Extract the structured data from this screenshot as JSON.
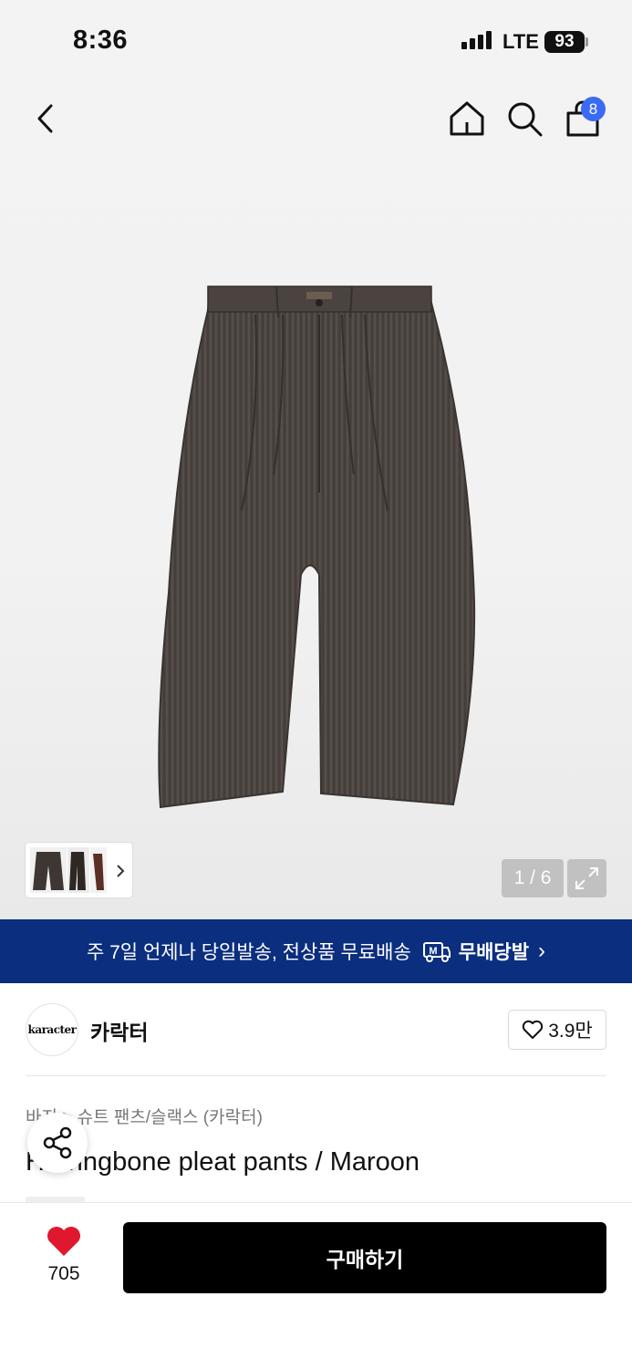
{
  "status_bar": {
    "time": "8:36",
    "network": "LTE",
    "battery": "93"
  },
  "nav": {
    "cart_count": "8",
    "icons": [
      "back-icon",
      "home-icon",
      "search-icon",
      "cart-icon"
    ]
  },
  "gallery": {
    "counter": "1 / 6",
    "icons": [
      "chevron-right-icon",
      "expand-icon"
    ]
  },
  "banner": {
    "text": "주 7일 언제나 당일발송, 전상품 무료배송",
    "brand": "무배당발",
    "chevron": "›"
  },
  "seller": {
    "logo_text": "karacter",
    "name": "카락터",
    "likes": "3.9만"
  },
  "product": {
    "breadcrumb": "바지 > 슈트 팬츠/슬랙스 (카락터)",
    "title": "Herringbone pleat pants / Maroon"
  },
  "bottom": {
    "like_count": "705",
    "buy_label": "구매하기"
  },
  "colors": {
    "banner_bg": "#0b2e7e",
    "badge": "#3b6bf5",
    "heart": "#e0182f",
    "buy_bg": "#000000"
  }
}
